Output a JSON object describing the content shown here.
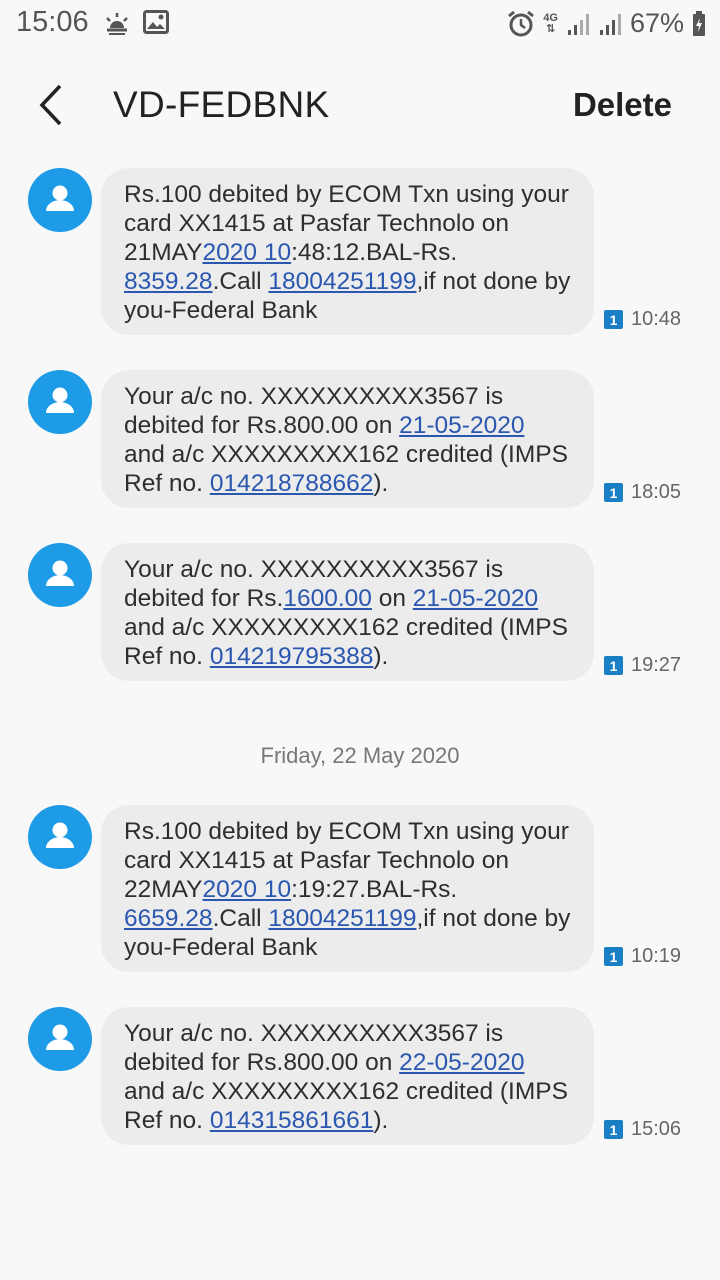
{
  "status_bar": {
    "time": "15:06",
    "network": "4G",
    "battery_pct": "67%"
  },
  "header": {
    "title": "VD-FEDBNK",
    "delete_label": "Delete"
  },
  "date_separator": "Friday, 22 May 2020",
  "messages": [
    {
      "time": "10:48",
      "sim": "1",
      "parts": [
        {
          "t": "Rs.100 debited by ECOM Txn using your card XX1415 at Pasfar Technolo on 21MAY"
        },
        {
          "t": "2020 10",
          "link": true
        },
        {
          "t": ":48:12.BAL-Rs. "
        },
        {
          "t": "8359.28",
          "link": true
        },
        {
          "t": ".Call "
        },
        {
          "t": "18004251199",
          "link": true
        },
        {
          "t": ",if not done by you-Federal Bank"
        }
      ]
    },
    {
      "time": "18:05",
      "sim": "1",
      "parts": [
        {
          "t": "Your a/c no. XXXXXXXXXX3567 is debited for Rs.800.00 on "
        },
        {
          "t": "21-05-2020",
          "link": true
        },
        {
          "t": " and a/c XXXXXXXXX162 credited (IMPS Ref no. "
        },
        {
          "t": "014218788662",
          "link": true
        },
        {
          "t": ")."
        }
      ]
    },
    {
      "time": "19:27",
      "sim": "1",
      "parts": [
        {
          "t": "Your a/c no. XXXXXXXXXX3567 is debited for Rs."
        },
        {
          "t": "1600.00",
          "link": true
        },
        {
          "t": " on "
        },
        {
          "t": "21-05-2020",
          "link": true
        },
        {
          "t": " and a/c XXXXXXXXX162 credited (IMPS Ref no. "
        },
        {
          "t": "014219795388",
          "link": true
        },
        {
          "t": ")."
        }
      ]
    },
    {
      "time": "10:19",
      "sim": "1",
      "parts": [
        {
          "t": "Rs.100 debited by ECOM Txn using your card XX1415 at Pasfar Technolo on 22MAY"
        },
        {
          "t": "2020 10",
          "link": true
        },
        {
          "t": ":19:27.BAL-Rs. "
        },
        {
          "t": "6659.28",
          "link": true
        },
        {
          "t": ".Call "
        },
        {
          "t": "18004251199",
          "link": true
        },
        {
          "t": ",if not done by you-Federal Bank"
        }
      ]
    },
    {
      "time": "15:06",
      "sim": "1",
      "parts": [
        {
          "t": "Your a/c no. XXXXXXXXXX3567 is debited for Rs.800.00 on "
        },
        {
          "t": "22-05-2020",
          "link": true
        },
        {
          "t": " and a/c XXXXXXXXX162 credited (IMPS Ref no. "
        },
        {
          "t": "014315861661",
          "link": true
        },
        {
          "t": ")."
        }
      ]
    }
  ],
  "colors": {
    "avatar": "#1e9be6",
    "bubble": "#ececec",
    "link": "#2a57b0",
    "sim_badge": "#1a7fc4"
  }
}
